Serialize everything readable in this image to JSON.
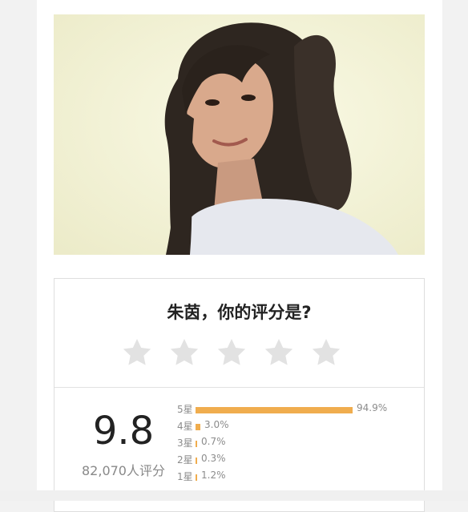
{
  "photo": {
    "subject": "portrait-photo"
  },
  "rating_prompt": {
    "question": "朱茵，你的评分是?",
    "stars": [
      "1星",
      "2星",
      "3星",
      "4星",
      "5星"
    ],
    "star_color": "#e2e2e2"
  },
  "summary": {
    "score": "9.8",
    "count": "82,070人评分"
  },
  "distribution": {
    "bar_color": "#f0ad4e",
    "rows": [
      {
        "label": "5星",
        "percent_text": "94.9%",
        "value": 94.9
      },
      {
        "label": "4星",
        "percent_text": "3.0%",
        "value": 3.0
      },
      {
        "label": "3星",
        "percent_text": "0.7%",
        "value": 0.7
      },
      {
        "label": "2星",
        "percent_text": "0.3%",
        "value": 0.3
      },
      {
        "label": "1星",
        "percent_text": "1.2%",
        "value": 1.2
      }
    ]
  }
}
